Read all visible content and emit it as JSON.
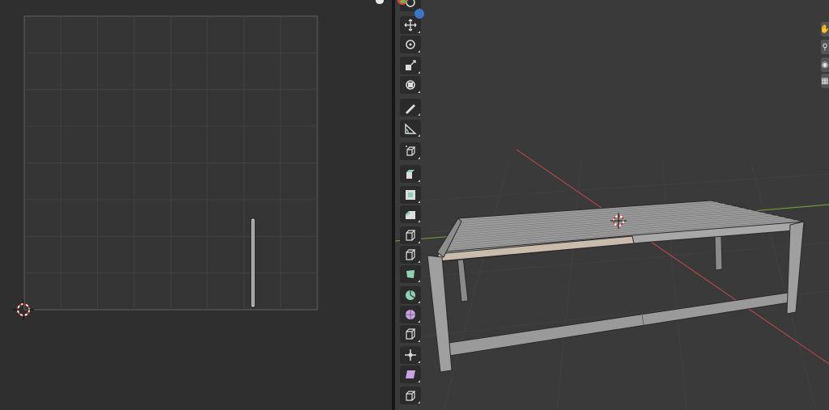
{
  "uv_editor": {
    "grid_divisions": 8,
    "cursor": "2d-cursor-icon",
    "island": "uv-island-strip"
  },
  "viewport": {
    "axis_colors": {
      "x": "#c0494e",
      "y": "#7ba33a"
    },
    "mesh": "table-wireframe",
    "selected_face_color": "#c9bcad",
    "origin_icon": "object-origin-icon",
    "gizmo": {
      "x_color": "#e23a52",
      "z_color": "#3d76c8",
      "y_color": "#6dbb3a"
    },
    "header_buttons": [
      {
        "id": "view",
        "icon": "hand-icon"
      },
      {
        "id": "zoom",
        "icon": "magnifier-icon"
      },
      {
        "id": "camera",
        "icon": "camera-icon"
      },
      {
        "id": "ortho",
        "icon": "grid-icon"
      }
    ]
  },
  "toolbar": {
    "tools": [
      {
        "id": "cursor",
        "icon": "cursor-icon",
        "active": false
      },
      {
        "id": "move",
        "icon": "move-icon",
        "active": false
      },
      {
        "id": "rotate",
        "icon": "rotate-icon",
        "active": false
      },
      {
        "id": "scale",
        "icon": "scale-icon",
        "active": false
      },
      {
        "id": "transform",
        "icon": "transform-icon",
        "active": false
      },
      {
        "id": "annotate",
        "icon": "annotate-icon",
        "active": false
      },
      {
        "id": "measure",
        "icon": "measure-icon",
        "active": false
      },
      {
        "id": "add-cube",
        "icon": "add-cube-icon",
        "active": false
      },
      {
        "id": "extrude",
        "icon": "extrude-icon",
        "active": false
      },
      {
        "id": "inset",
        "icon": "inset-icon",
        "active": false
      },
      {
        "id": "bevel",
        "icon": "bevel-icon",
        "active": false
      },
      {
        "id": "loop-cut",
        "icon": "loop-cut-icon",
        "active": false
      },
      {
        "id": "knife",
        "icon": "knife-icon",
        "active": false
      },
      {
        "id": "poly-build",
        "icon": "poly-build-icon",
        "active": false
      },
      {
        "id": "spin",
        "icon": "spin-icon",
        "active": false
      },
      {
        "id": "smooth",
        "icon": "smooth-icon",
        "active": false
      },
      {
        "id": "edge-slide",
        "icon": "edge-slide-icon",
        "active": false
      },
      {
        "id": "shrink-fatten",
        "icon": "shrink-fatten-icon",
        "active": false
      },
      {
        "id": "shear",
        "icon": "shear-icon",
        "active": false
      },
      {
        "id": "rip",
        "icon": "rip-icon",
        "active": false
      }
    ]
  }
}
